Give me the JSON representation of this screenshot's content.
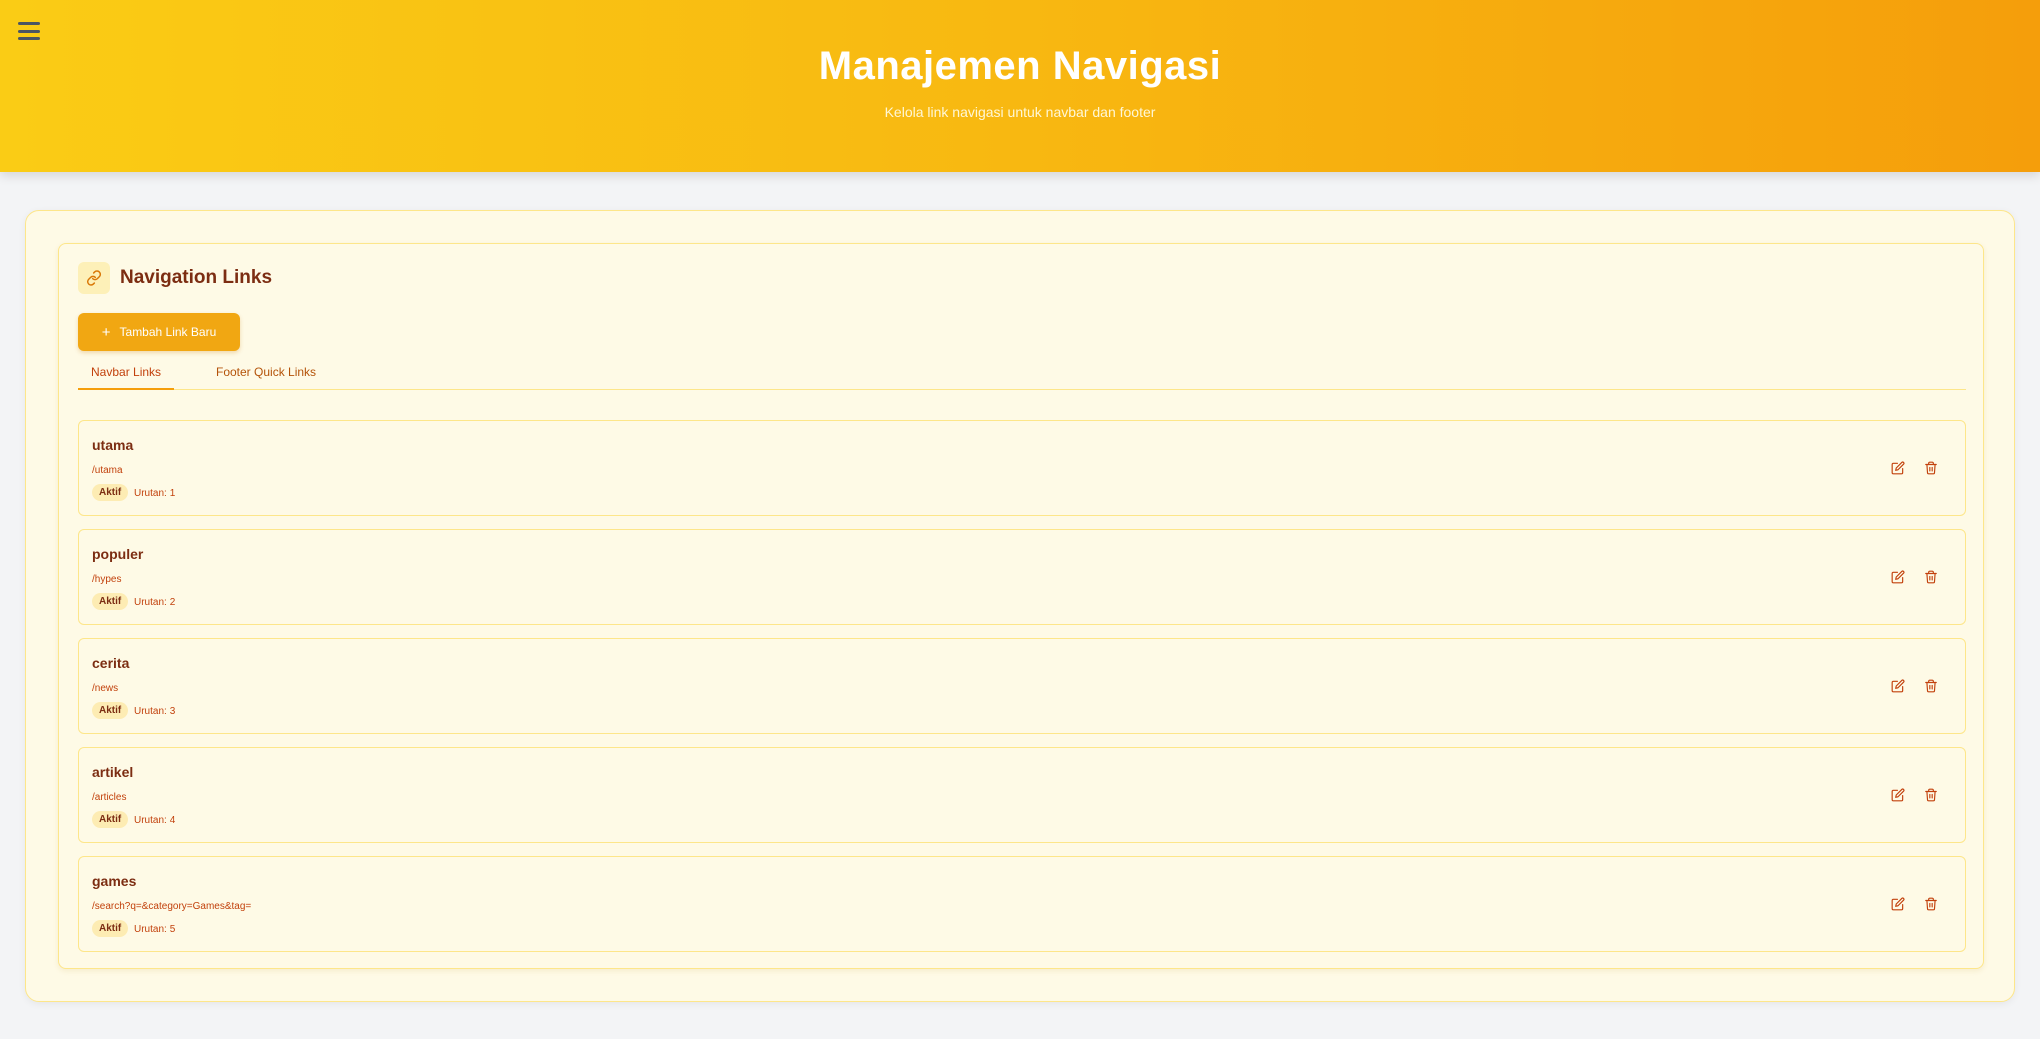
{
  "header": {
    "menu_icon": "hamburger-menu-icon",
    "title": "Manajemen Navigasi",
    "subtitle": "Kelola link navigasi untuk navbar dan footer"
  },
  "section": {
    "icon": "link-icon",
    "title": "Navigation Links",
    "add_button": "Tambah Link Baru"
  },
  "tabs": [
    {
      "label": "Navbar Links",
      "active": true
    },
    {
      "label": "Footer Quick Links",
      "active": false
    }
  ],
  "order_label": "Urutan:",
  "links": [
    {
      "name": "utama",
      "path": "/utama",
      "status": "Aktif",
      "order": "1"
    },
    {
      "name": "populer",
      "path": "/hypes",
      "status": "Aktif",
      "order": "2"
    },
    {
      "name": "cerita",
      "path": "/news",
      "status": "Aktif",
      "order": "3"
    },
    {
      "name": "artikel",
      "path": "/articles",
      "status": "Aktif",
      "order": "4"
    },
    {
      "name": "games",
      "path": "/search?q=&category=Games&tag=",
      "status": "Aktif",
      "order": "5"
    }
  ],
  "colors": {
    "header_gradient_start": "#facc15",
    "header_gradient_end": "#f59e0b",
    "accent": "#f1a712",
    "text_dark": "#7c2d12",
    "text_link": "#c2410c"
  }
}
